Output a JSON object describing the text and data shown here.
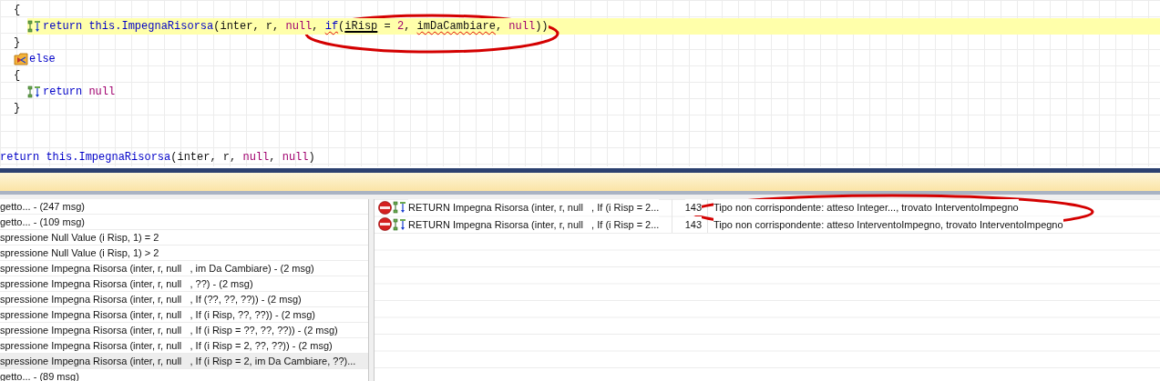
{
  "code": {
    "lines": [
      {
        "kind": "group",
        "children": [
          {
            "kind": "text",
            "selected": false,
            "tokens": [
              {
                "text": "{",
                "kind": "punct"
              }
            ]
          },
          {
            "kind": "group",
            "children": [
              {
                "kind": "return",
                "selected": true,
                "tokens": [
                  {
                    "text": "return",
                    "kind": "keyword",
                    "error": false,
                    "underlined": false
                  },
                  {
                    "text": " this.ImpegnaRisorsa",
                    "kind": "keyword",
                    "error": false,
                    "underlined": false
                  },
                  {
                    "text": "(inter, r, ",
                    "kind": "punct",
                    "error": false,
                    "underlined": false
                  },
                  {
                    "text": "null",
                    "kind": "literal",
                    "error": false,
                    "underlined": false
                  },
                  {
                    "text": ", ",
                    "kind": "punct",
                    "error": false,
                    "underlined": false
                  },
                  {
                    "text": "if",
                    "kind": "keyword",
                    "error": true,
                    "underlined": false
                  },
                  {
                    "text": "(",
                    "kind": "punct",
                    "error": false,
                    "underlined": false
                  },
                  {
                    "text": "iRisp",
                    "kind": "punct",
                    "error": false,
                    "underlined": true
                  },
                  {
                    "text": " = ",
                    "kind": "punct",
                    "error": false,
                    "underlined": false
                  },
                  {
                    "text": "2",
                    "kind": "literal",
                    "error": false,
                    "underlined": false
                  },
                  {
                    "text": ", ",
                    "kind": "punct",
                    "error": false,
                    "underlined": false
                  },
                  {
                    "text": "imDaCambiare",
                    "kind": "punct",
                    "error": true,
                    "underlined": false
                  },
                  {
                    "text": ", ",
                    "kind": "punct",
                    "error": false,
                    "underlined": false
                  },
                  {
                    "text": "null",
                    "kind": "literal",
                    "error": false,
                    "underlined": false
                  },
                  {
                    "text": "))",
                    "kind": "punct",
                    "error": false,
                    "underlined": false
                  }
                ]
              }
            ]
          },
          {
            "kind": "text",
            "selected": false,
            "tokens": [
              {
                "text": "}",
                "kind": "punct"
              }
            ]
          },
          {
            "kind": "else",
            "selected": false,
            "tokens": [
              {
                "text": "else",
                "kind": "keyword"
              }
            ]
          },
          {
            "kind": "text",
            "selected": false,
            "tokens": [
              {
                "text": "{",
                "kind": "punct"
              }
            ]
          },
          {
            "kind": "group",
            "children": [
              {
                "kind": "return",
                "selected": false,
                "tokens": [
                  {
                    "text": "return",
                    "kind": "keyword"
                  },
                  {
                    "text": " null",
                    "kind": "literal"
                  }
                ]
              }
            ]
          },
          {
            "kind": "text",
            "selected": false,
            "tokens": [
              {
                "text": "}",
                "kind": "punct"
              }
            ]
          }
        ]
      },
      {
        "kind": "blank"
      },
      {
        "kind": "blank"
      },
      {
        "kind": "text",
        "selected": false,
        "tokens": [
          {
            "text": "return",
            "kind": "keyword"
          },
          {
            "text": " this.ImpegnaRisorsa",
            "kind": "keyword"
          },
          {
            "text": "(inter, r, ",
            "kind": "punct"
          },
          {
            "text": "null",
            "kind": "literal"
          },
          {
            "text": ", ",
            "kind": "punct"
          },
          {
            "text": "null",
            "kind": "literal"
          },
          {
            "text": ")",
            "kind": "punct"
          }
        ]
      }
    ]
  },
  "tree": {
    "items": [
      {
        "text": "getto... - (247 msg)",
        "selected": false
      },
      {
        "text": "getto... - (109 msg)",
        "selected": false
      },
      {
        "text": "spressione Null Value (i Risp, 1) = 2",
        "selected": false
      },
      {
        "text": "spressione Null Value (i Risp, 1) > 2",
        "selected": false
      },
      {
        "text": "spressione Impegna Risorsa (inter, r, null   , im Da Cambiare) - (2 msg)",
        "selected": false
      },
      {
        "text": "spressione Impegna Risorsa (inter, r, null   , ??) - (2 msg)",
        "selected": false
      },
      {
        "text": "spressione Impegna Risorsa (inter, r, null   , If (??, ??, ??)) - (2 msg)",
        "selected": false
      },
      {
        "text": "spressione Impegna Risorsa (inter, r, null   , If (i Risp, ??, ??)) - (2 msg)",
        "selected": false
      },
      {
        "text": "spressione Impegna Risorsa (inter, r, null   , If (i Risp = ??, ??, ??)) - (2 msg)",
        "selected": false
      },
      {
        "text": "spressione Impegna Risorsa (inter, r, null   , If (i Risp = 2, ??, ??)) - (2 msg)",
        "selected": false
      },
      {
        "text": "spressione Impegna Risorsa (inter, r, null   , If (i Risp = 2, im Da Cambiare, ??)...",
        "selected": true
      },
      {
        "text": "getto... - (89 msg)",
        "selected": false
      }
    ]
  },
  "messages": {
    "rows": [
      {
        "statement": "RETURN Impegna Risorsa (inter, r, null   , If (i Risp = 2...",
        "line": "143",
        "message": "Tipo non corrispondente: atteso Integer..., trovato InterventoImpegno"
      },
      {
        "statement": "RETURN Impegna Risorsa (inter, r, null   , If (i Risp = 2...",
        "line": "143",
        "message": "Tipo non corrispondente: atteso InterventoImpegno, trovato InterventoImpegno"
      }
    ]
  }
}
